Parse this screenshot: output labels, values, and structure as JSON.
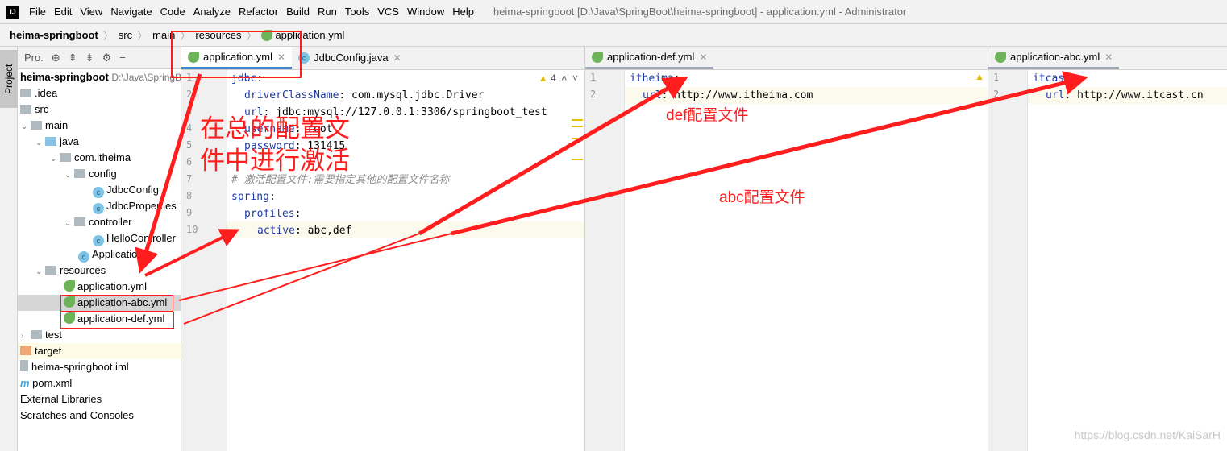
{
  "menubar": {
    "items": [
      "File",
      "Edit",
      "View",
      "Navigate",
      "Code",
      "Analyze",
      "Refactor",
      "Build",
      "Run",
      "Tools",
      "VCS",
      "Window",
      "Help"
    ],
    "window_title": "heima-springboot [D:\\Java\\SpringBoot\\heima-springboot] - application.yml - Administrator"
  },
  "breadcrumb": [
    "heima-springboot",
    "src",
    "main",
    "resources",
    "application.yml"
  ],
  "project_panel": {
    "tab": "Project",
    "toolbar_label": "Pro.",
    "root": "heima-springboot",
    "root_path": "D:\\Java\\SpringBoot",
    "items": [
      ".idea",
      "src",
      "main",
      "java",
      "com.itheima",
      "config",
      "JdbcConfig",
      "JdbcProperties",
      "controller",
      "HelloController",
      "Application",
      "resources",
      "application.yml",
      "application-abc.yml",
      "application-def.yml",
      "test",
      "target",
      "heima-springboot.iml",
      "pom.xml",
      "External Libraries",
      "Scratches and Consoles"
    ]
  },
  "editor1": {
    "tabs": [
      "application.yml",
      "JdbcConfig.java"
    ],
    "warnings": "4",
    "lines": [
      {
        "n": "1",
        "key": "jdbc",
        "val": ""
      },
      {
        "n": "2",
        "key": "driverClassName",
        "val": " com.mysql.jdbc.Driver"
      },
      {
        "n": "3",
        "key": "url",
        "val": " jdbc:mysql://127.0.0.1:3306/springboot_test"
      },
      {
        "n": "4",
        "key": "username",
        "val": " root"
      },
      {
        "n": "5",
        "key": "password",
        "val": " 131415"
      },
      {
        "n": "6",
        "key": "",
        "val": ""
      },
      {
        "n": "7",
        "comment": "# 激活配置文件:需要指定其他的配置文件名称"
      },
      {
        "n": "8",
        "key": "spring",
        "val": ""
      },
      {
        "n": "9",
        "key": "profiles",
        "val": ""
      },
      {
        "n": "10",
        "key": "active",
        "val": " abc,def"
      }
    ]
  },
  "editor2": {
    "tab": "application-def.yml",
    "lines": [
      {
        "n": "1",
        "key": "itheima",
        "val": ""
      },
      {
        "n": "2",
        "key": "url",
        "val": " http://www.itheima.com"
      }
    ]
  },
  "editor3": {
    "tab": "application-abc.yml",
    "lines": [
      {
        "n": "1",
        "key": "itcase",
        "val": ""
      },
      {
        "n": "2",
        "key": "url",
        "val": " http://www.itcast.cn"
      }
    ]
  },
  "annotations": {
    "main": [
      "在总的配置文",
      "件中进行激活"
    ],
    "def": "def配置文件",
    "abc": "abc配置文件",
    "color": "#ff1d1d"
  },
  "watermark": "https://blog.csdn.net/KaiSarH"
}
